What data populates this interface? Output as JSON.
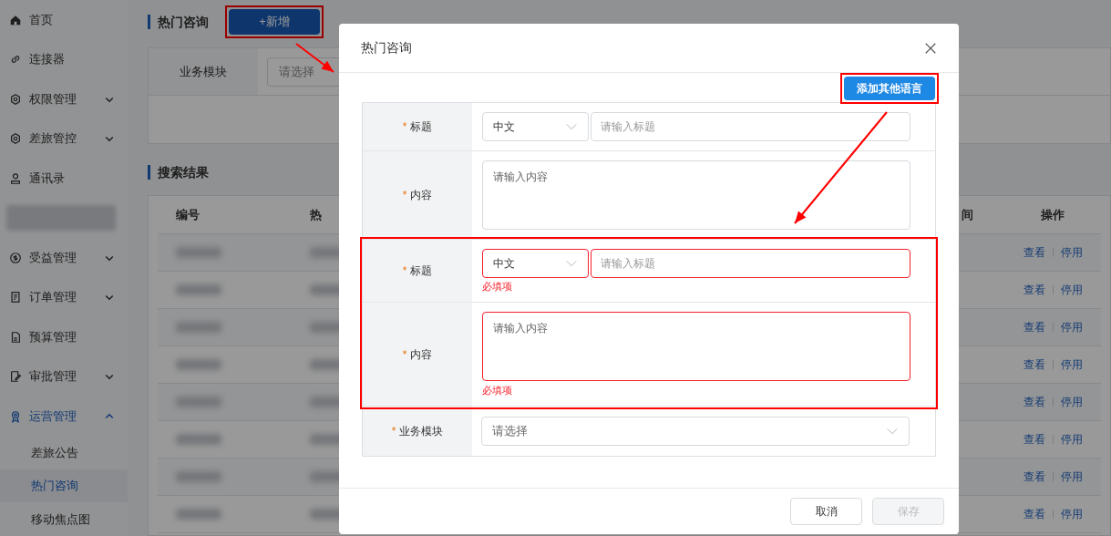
{
  "sidebar": {
    "items": [
      {
        "kind": "link",
        "label": "首页",
        "selected": false
      },
      {
        "kind": "link",
        "label": "连接器",
        "selected": false
      },
      {
        "kind": "group",
        "label": "权限管理",
        "selected": false,
        "expanded": false
      },
      {
        "kind": "group",
        "label": "差旅管控",
        "selected": false,
        "expanded": false
      },
      {
        "kind": "link",
        "label": "通讯录",
        "selected": false
      },
      {
        "kind": "redacted"
      },
      {
        "kind": "group",
        "label": "受益管理",
        "selected": false,
        "expanded": false
      },
      {
        "kind": "group",
        "label": "订单管理",
        "selected": false,
        "expanded": false
      },
      {
        "kind": "link",
        "label": "预算管理",
        "selected": false
      },
      {
        "kind": "group",
        "label": "审批管理",
        "selected": false,
        "expanded": false
      },
      {
        "kind": "group",
        "label": "运营管理",
        "selected": true,
        "expanded": true,
        "children": [
          {
            "label": "差旅公告",
            "selected": false
          },
          {
            "label": "热门咨询",
            "selected": true
          },
          {
            "label": "移动焦点图",
            "selected": false
          }
        ]
      }
    ]
  },
  "page": {
    "title": "热门咨询",
    "add_button": {
      "label": "+新增",
      "highlighted": true
    },
    "filter": {
      "label": "业务模块",
      "placeholder": "请选择"
    },
    "results_title": "搜索结果",
    "table": {
      "columns": [
        "编号",
        "热",
        "间",
        "操作"
      ],
      "rows": [
        {
          "actions": [
            "查看",
            "停用"
          ]
        },
        {
          "actions": [
            "查看",
            "停用"
          ]
        },
        {
          "actions": [
            "查看",
            "停用"
          ]
        },
        {
          "actions": [
            "查看",
            "停用"
          ]
        },
        {
          "actions": [
            "查看",
            "停用"
          ]
        },
        {
          "actions": [
            "查看",
            "停用"
          ]
        },
        {
          "actions": [
            "查看",
            "停用"
          ]
        },
        {
          "actions": [
            "查看",
            "停用"
          ]
        }
      ]
    }
  },
  "dialog": {
    "title": "热门咨询",
    "add_language_button": {
      "label": "添加其他语言",
      "highlighted": true
    },
    "groups": [
      {
        "highlighted": false,
        "title_required_mark": "*",
        "title_label": "标题",
        "language": "中文",
        "title_placeholder": "请输入标题",
        "content_required_mark": "*",
        "content_label": "内容",
        "content_placeholder": "请输入内容"
      },
      {
        "highlighted": true,
        "title_required_mark": "*",
        "title_label": "标题",
        "language": "中文",
        "title_placeholder": "请输入标题",
        "title_error": "必填项",
        "content_required_mark": "*",
        "content_label": "内容",
        "content_placeholder": "请输入内容",
        "content_error": "必填项"
      }
    ],
    "module": {
      "required_mark": "*",
      "label": "业务模块",
      "placeholder": "请选择"
    },
    "buttons": [
      {
        "kind": "cancel",
        "label": "取消",
        "disabled": false
      },
      {
        "kind": "save",
        "label": "保存",
        "disabled": true
      }
    ]
  }
}
